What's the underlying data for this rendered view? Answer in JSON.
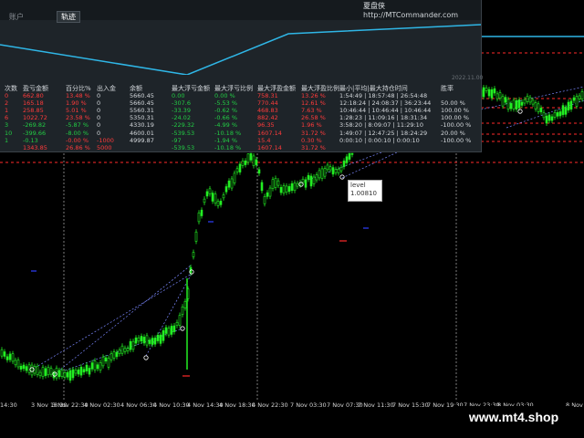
{
  "panel": {
    "brand_name": "夏盘侠",
    "brand_url": "http://MTCommander.com",
    "tabs": [
      "账户",
      "轨迹"
    ],
    "active_tab": "轨迹",
    "date_label": "2022.11.00",
    "headers": [
      "次数",
      "盈亏金额",
      "百分比%",
      "出入金",
      "余额",
      "最大浮亏金额",
      "最大浮亏比例",
      "最大浮盈金额",
      "最大浮盈比例",
      "最小|平均|最大持仓时间",
      "胜率"
    ],
    "rows": [
      {
        "num": "0",
        "pl": "662.80",
        "pct": "13.48 %",
        "io": "0",
        "bal": "5660.45",
        "maxloss": "0.00",
        "maxloss_pct": "0.00 %",
        "maxgain": "758.31",
        "maxgain_pct": "13.26 %",
        "hold": "1:54:49 | 18:57:48 | 26:54:48",
        "win": ""
      },
      {
        "num": "2",
        "pl": "165.18",
        "pct": "1.90 %",
        "io": "0",
        "bal": "5660.45",
        "maxloss": "-307.6",
        "maxloss_pct": "-5.53 %",
        "maxgain": "770.44",
        "maxgain_pct": "12.61 %",
        "hold": "12:18:24 | 24:08:37 | 36:23:44",
        "win": "50.00 %"
      },
      {
        "num": "1",
        "pl": "258.85",
        "pct": "5.01 %",
        "io": "0",
        "bal": "5560.31",
        "maxloss": "-33.39",
        "maxloss_pct": "-0.62 %",
        "maxgain": "468.83",
        "maxgain_pct": "7.63 %",
        "hold": "10:46:44 | 10:46:44 | 10:46:44",
        "win": "100.00 %"
      },
      {
        "num": "6",
        "pl": "1022.72",
        "pct": "23.58 %",
        "io": "0",
        "bal": "5350.31",
        "maxloss": "-24.02",
        "maxloss_pct": "-0.66 %",
        "maxgain": "882.42",
        "maxgain_pct": "26.58 %",
        "hold": "1:28:23 | 11:09:16 | 18:31:34",
        "win": "100.00 %"
      },
      {
        "num": "3",
        "pl": "-269.82",
        "pct": "-5.87 %",
        "io": "0",
        "bal": "4330.19",
        "maxloss": "-229.32",
        "maxloss_pct": "-4.99 %",
        "maxgain": "96.35",
        "maxgain_pct": "1.96 %",
        "hold": "3:58:20 | 8:09:07 | 11:29:10",
        "win": "-100.00 %"
      },
      {
        "num": "10",
        "pl": "-399.66",
        "pct": "-8.00 %",
        "io": "0",
        "bal": "4600.01",
        "maxloss": "-539.53",
        "maxloss_pct": "-10.18 %",
        "maxgain": "1607.14",
        "maxgain_pct": "31.72 %",
        "hold": "1:49:07 | 12:47:25 | 18:24:29",
        "win": "20.00 %"
      },
      {
        "num": "1",
        "pl": "-0.13",
        "pct": "-0.00 %",
        "io": "-1000",
        "bal": "4999.87",
        "maxloss": "-97",
        "maxloss_pct": "-1.94 %",
        "maxgain": "15.4",
        "maxgain_pct": "0.30 %",
        "hold": "0:00:10 | 0:00:10 | 0:00:10",
        "win": "-100.00 %"
      },
      {
        "num": "",
        "pl": "1343.85",
        "pct": "26.86 %",
        "io": "5000",
        "bal": "",
        "maxloss": "-539.53",
        "maxloss_pct": "-10.18 %",
        "maxgain": "1607.14",
        "maxgain_pct": "31.72 %",
        "hold": "",
        "win": ""
      }
    ]
  },
  "level": {
    "label": "level",
    "value": "1.00810"
  },
  "xaxis": {
    "ticks": [
      "14:30",
      "3 Nov 18:30",
      "3 Nov 22:30",
      "4 Nov 02:30",
      "4 Nov 06:30",
      "4 Nov 10:30",
      "4 Nov 14:30",
      "4 Nov 18:30",
      "4 Nov 22:30",
      "7 Nov 03:30",
      "7 Nov 07:30",
      "7 Nov 11:30",
      "7 Nov 15:30",
      "7 Nov 19:30",
      "7 Nov 23:30",
      "8 Nov 03:30",
      "8 Nov"
    ]
  },
  "site": "www.mt4.shop",
  "colors": {
    "bull": "#22ee22",
    "bear": "#22ee22",
    "panel_bg": "#1e2429",
    "profit": "#ff3b3b",
    "loss": "#22cc44",
    "equity_line": "#2fb6e6",
    "level_line": "#ff2a2a"
  }
}
